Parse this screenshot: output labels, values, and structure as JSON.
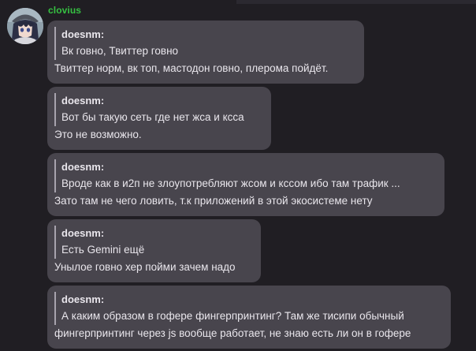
{
  "author": {
    "name": "clovius",
    "color": "#36c142"
  },
  "avatar": {
    "icon": "anime-avatar-icon"
  },
  "messages": [
    {
      "quote": {
        "author": "doesnm:",
        "lines": [
          "Вк говно, Твиттер говно"
        ]
      },
      "reply": [
        "Твиттер норм, вк топ, мастодон говно, плерома пойдёт."
      ]
    },
    {
      "quote": {
        "author": "doesnm:",
        "lines": [
          "Вот бы такую сеть где нет жса и ксса"
        ]
      },
      "reply": [
        "Это не возможно."
      ]
    },
    {
      "quote": {
        "author": "doesnm:",
        "lines": [
          "Вроде как в и2п не злоупотребляют жсом и кссом ибо там трафик ..."
        ]
      },
      "reply": [
        "Зато там не чего ловить, т.к приложений в этой экосистеме нету"
      ]
    },
    {
      "quote": {
        "author": "doesnm:",
        "lines": [
          "Есть Gemini ещё"
        ]
      },
      "reply": [
        "Унылое говно хер пойми зачем надо"
      ]
    },
    {
      "quote": {
        "author": "doesnm:",
        "lines": [
          "А каким образом в гофере фингерпринтинг? Там же тисипи обычный"
        ]
      },
      "reply": [
        "фингерпринтинг через js вообще работает, не знаю есть ли он в гофере"
      ]
    }
  ],
  "colors": {
    "background": "#201e23",
    "bubble": "#48454d",
    "quote_bar": "#a7a3ad"
  }
}
